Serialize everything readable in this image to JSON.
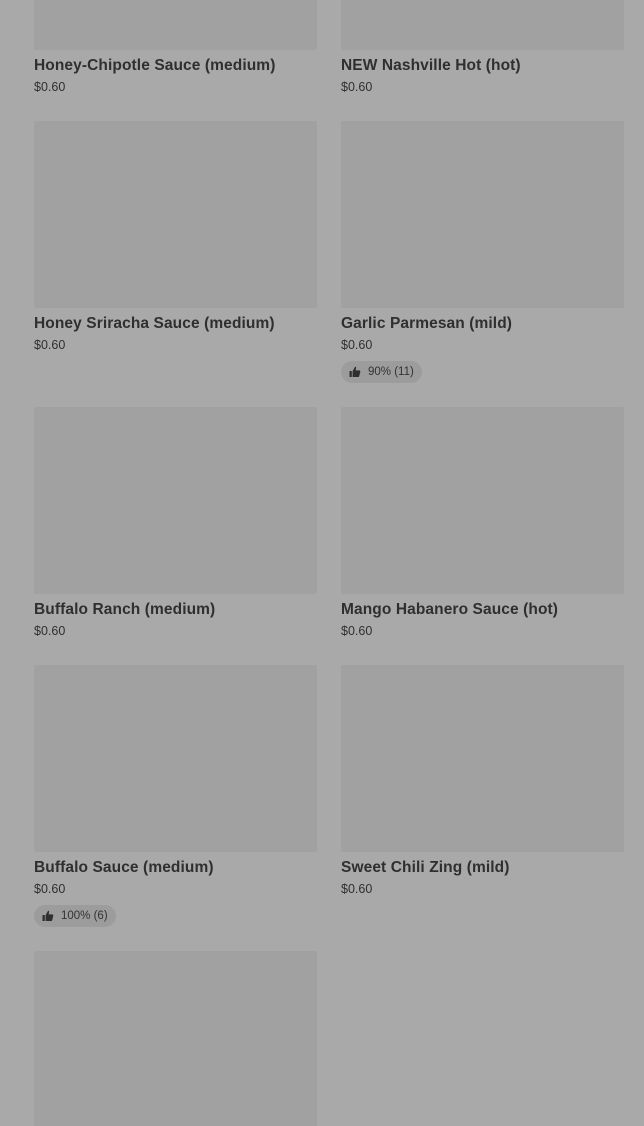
{
  "menu_items": [
    {
      "name": "Honey-Chipotle Sauce (medium)",
      "price": "$0.60",
      "rating": null
    },
    {
      "name": "NEW Nashville Hot (hot)",
      "price": "$0.60",
      "rating": null
    },
    {
      "name": "Honey Sriracha Sauce (medium)",
      "price": "$0.60",
      "rating": null
    },
    {
      "name": "Garlic Parmesan (mild)",
      "price": "$0.60",
      "rating": "90% (11)"
    },
    {
      "name": "Buffalo Ranch (medium)",
      "price": "$0.60",
      "rating": null
    },
    {
      "name": "Mango Habanero Sauce (hot)",
      "price": "$0.60",
      "rating": null
    },
    {
      "name": "Buffalo Sauce (medium)",
      "price": "$0.60",
      "rating": "100% (6)"
    },
    {
      "name": "Sweet Chili Zing (mild)",
      "price": "$0.60",
      "rating": null
    }
  ],
  "icons": {
    "rating_icon": "thumbs-up-icon"
  },
  "colors": {
    "page_background": "#a9a9a9",
    "image_placeholder": "#a1a1a1",
    "rating_pill": "#9c9c9c",
    "text": "#2f2f2f"
  }
}
